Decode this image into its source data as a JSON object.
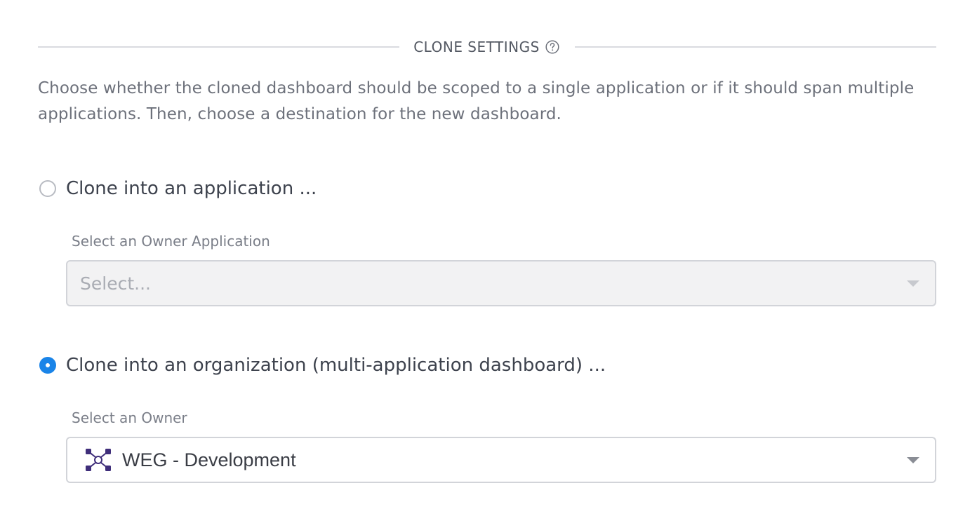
{
  "section": {
    "title": "CLONE SETTINGS",
    "help_icon": "question-circle-icon"
  },
  "description": "Choose whether the cloned dashboard should be scoped to a single application or if it should span multiple applications. Then, choose a destination for the new dashboard.",
  "options": {
    "application": {
      "label": "Clone into an application ...",
      "selected": false,
      "field_label": "Select an Owner Application",
      "placeholder": "Select...",
      "disabled": true
    },
    "organization": {
      "label": "Clone into an organization (multi-application dashboard) ...",
      "selected": true,
      "field_label": "Select an Owner",
      "value": "WEG - Development",
      "value_icon": "network-nodes-icon"
    }
  },
  "colors": {
    "accent": "#1a84e8",
    "org_icon": "#3f2e7a"
  }
}
